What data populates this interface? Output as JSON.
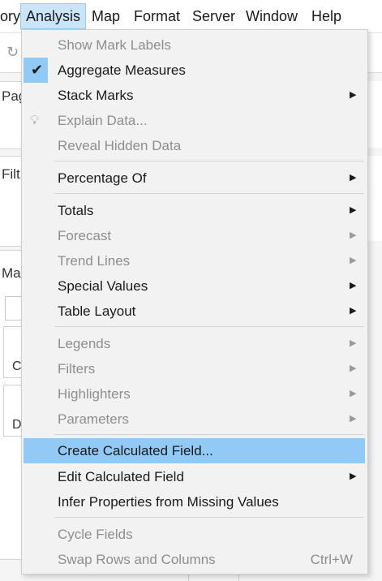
{
  "menubar": {
    "items": [
      {
        "label": "ory"
      },
      {
        "label": "Analysis"
      },
      {
        "label": "Map"
      },
      {
        "label": "Format"
      },
      {
        "label": "Server"
      },
      {
        "label": "Window"
      },
      {
        "label": "Help"
      }
    ]
  },
  "background": {
    "pages_label": "Pag",
    "filters_label": "Filt",
    "marks_label": "Ma",
    "card_c_label": "C",
    "card_d_label": "D"
  },
  "analysis_menu": {
    "items": [
      {
        "label": "Show Mark Labels",
        "enabled": false
      },
      {
        "label": "Aggregate Measures",
        "enabled": true,
        "checked": true
      },
      {
        "label": "Stack Marks",
        "enabled": true,
        "submenu": true
      },
      {
        "label": "Explain Data...",
        "enabled": false,
        "icon": "lightbulb-icon"
      },
      {
        "label": "Reveal Hidden Data",
        "enabled": false
      },
      {
        "label": "Percentage Of",
        "enabled": true,
        "submenu": true
      },
      {
        "label": "Totals",
        "enabled": true,
        "submenu": true
      },
      {
        "label": "Forecast",
        "enabled": false,
        "submenu": true
      },
      {
        "label": "Trend Lines",
        "enabled": false,
        "submenu": true
      },
      {
        "label": "Special Values",
        "enabled": true,
        "submenu": true
      },
      {
        "label": "Table Layout",
        "enabled": true,
        "submenu": true
      },
      {
        "label": "Legends",
        "enabled": false,
        "submenu": true
      },
      {
        "label": "Filters",
        "enabled": false,
        "submenu": true
      },
      {
        "label": "Highlighters",
        "enabled": false,
        "submenu": true
      },
      {
        "label": "Parameters",
        "enabled": false,
        "submenu": true
      },
      {
        "label": "Create Calculated Field...",
        "enabled": true,
        "highlighted": true
      },
      {
        "label": "Edit Calculated Field",
        "enabled": true,
        "submenu": true
      },
      {
        "label": "Infer Properties from Missing Values",
        "enabled": true
      },
      {
        "label": "Cycle Fields",
        "enabled": false
      },
      {
        "label": "Swap Rows and Columns",
        "enabled": false,
        "shortcut": "Ctrl+W"
      }
    ]
  },
  "colors": {
    "highlight": "#91c9f7",
    "active_menu": "#cce4f7",
    "disabled_text": "#8e8e8e"
  }
}
